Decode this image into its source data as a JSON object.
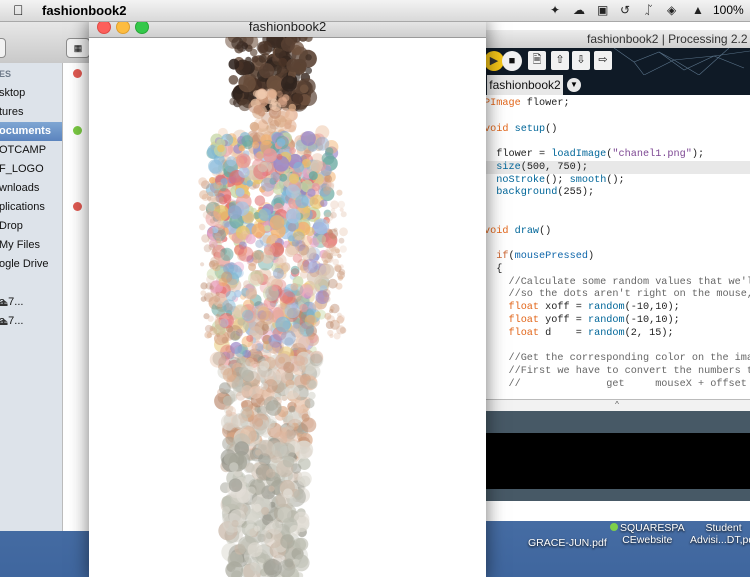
{
  "menubar": {
    "apple_icon": "apple-icon",
    "app_name": "fashionbook2",
    "battery": "100%",
    "icons": [
      "dropbox-icon",
      "creative-cloud-icon",
      "box-icon",
      "time-machine-icon",
      "bluetooth-icon",
      "wifi-icon",
      "volume-icon"
    ]
  },
  "finder": {
    "sidebar": [
      {
        "label": "ES",
        "type": "header"
      },
      {
        "label": "sktop"
      },
      {
        "label": "tures"
      },
      {
        "label": "ocuments",
        "selected": true
      },
      {
        "label": "OTCAMP"
      },
      {
        "label": "F_LOGO"
      },
      {
        "label": "wnloads"
      },
      {
        "label": "plications"
      },
      {
        "label": "Drop"
      },
      {
        "label": " My Files"
      },
      {
        "label": "ogle Drive"
      },
      {
        "label": ""
      },
      {
        "label": "a 7...",
        "eject": true
      },
      {
        "label": "a 7...",
        "eject": true
      }
    ],
    "list_dots": [
      {
        "row": 0,
        "color": "#e05a52"
      },
      {
        "row": 3,
        "color": "#7ac943"
      },
      {
        "row": 7,
        "color": "#e05a52"
      }
    ]
  },
  "sketch": {
    "title": "fashionbook2"
  },
  "pde": {
    "title": "fashionbook2 | Processing 2.2",
    "tab": "fashionbook2",
    "code": [
      {
        "t": "PImage flower;"
      },
      {
        "t": ""
      },
      {
        "t": "void setup()"
      },
      {
        "t": ""
      },
      {
        "t": "  flower = loadImage(\"chanel1.png\");"
      },
      {
        "t": "  size(500, 750);",
        "hl": true
      },
      {
        "t": "  noStroke(); smooth();"
      },
      {
        "t": "  background(255);"
      },
      {
        "t": ""
      },
      {
        "t": ""
      },
      {
        "t": "void draw()"
      },
      {
        "t": ""
      },
      {
        "t": "  if(mousePressed)"
      },
      {
        "t": "  {"
      },
      {
        "t": "    //Calculate some random values that we'll use"
      },
      {
        "t": "    //so the dots aren't right on the mouse, but"
      },
      {
        "t": "    float xoff = random(-10,10);"
      },
      {
        "t": "    float yoff = random(-10,10);"
      },
      {
        "t": "    float d    = random(2, 15);"
      },
      {
        "t": ""
      },
      {
        "t": "    //Get the corresponding color on the image."
      },
      {
        "t": "    //First we have to convert the numbers to in"
      },
      {
        "t": "    //              get     mouseX + offset"
      }
    ]
  },
  "desktop_icons": [
    {
      "label1": "GRACE-JUN.pdf",
      "label2": ""
    },
    {
      "label1": "SQUARESPA",
      "label2": "CEwebsite"
    },
    {
      "label1": "Student",
      "label2": "Advisi...DT,pdf"
    }
  ],
  "colors": {
    "close": "#fc605b",
    "minimize": "#fdbc40",
    "zoom": "#34c84a",
    "run": "#f5c518",
    "stop": "#f1f1f1"
  }
}
